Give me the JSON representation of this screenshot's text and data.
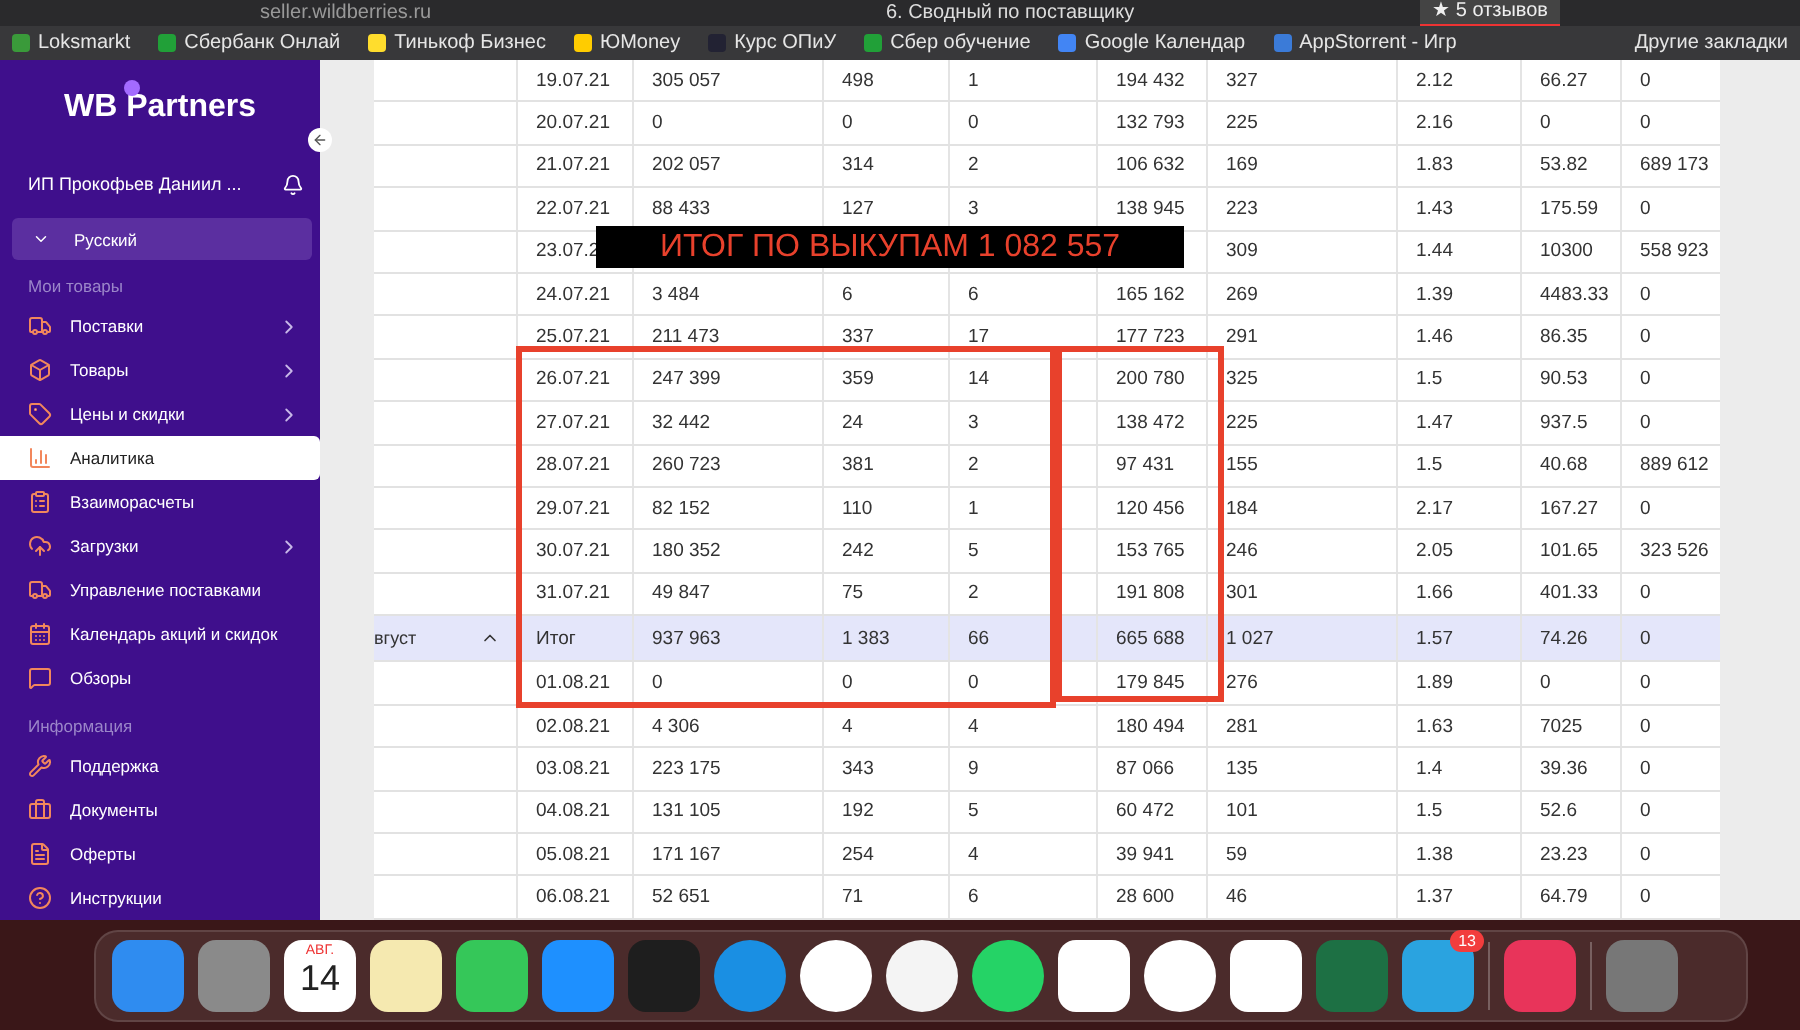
{
  "browser": {
    "address": "seller.wildberries.ru",
    "title": "6. Сводный по поставщику",
    "reviews": "★ 5 отзывов"
  },
  "bookmarks": [
    "Loksmarkt",
    "Сбербанк Онлай",
    "Тинькоф Бизнес",
    "ЮMoney",
    "Курс ОПиУ",
    "Сбер обучение",
    "Google Календар",
    "AppStorrent - Игр"
  ],
  "other_bookmarks": "Другие закладки",
  "sidebar": {
    "logo": "WB Partners",
    "user": "ИП Прокофьев Даниил ...",
    "language": "Русский",
    "sections": [
      {
        "title": "Мои товары",
        "items": [
          {
            "label": "Поставки",
            "submenu": true,
            "selected": false
          },
          {
            "label": "Товары",
            "submenu": true,
            "selected": false
          },
          {
            "label": "Цены и скидки",
            "submenu": true,
            "selected": false
          },
          {
            "label": "Аналитика",
            "submenu": false,
            "selected": true
          },
          {
            "label": "Взаиморасчеты",
            "submenu": false,
            "selected": false
          },
          {
            "label": "Загрузки",
            "submenu": true,
            "selected": false
          },
          {
            "label": "Управление поставками",
            "submenu": false,
            "selected": false
          },
          {
            "label": "Календарь акций и скидок",
            "submenu": false,
            "selected": false
          },
          {
            "label": "Обзоры",
            "submenu": false,
            "selected": false
          }
        ]
      },
      {
        "title": "Информация",
        "items": [
          {
            "label": "Поддержка",
            "submenu": false,
            "selected": false
          },
          {
            "label": "Документы",
            "submenu": false,
            "selected": false
          },
          {
            "label": "Оферты",
            "submenu": false,
            "selected": false
          },
          {
            "label": "Инструкции",
            "submenu": false,
            "selected": false
          }
        ]
      }
    ]
  },
  "table": {
    "rows": [
      {
        "kind": "day",
        "cells": [
          "19.07.21",
          "305 057",
          "498",
          "1",
          "194 432",
          "327",
          "2.12",
          "66.27",
          "0"
        ]
      },
      {
        "kind": "day",
        "cells": [
          "20.07.21",
          "0",
          "0",
          "0",
          "132 793",
          "225",
          "2.16",
          "0",
          "0"
        ]
      },
      {
        "kind": "day",
        "cells": [
          "21.07.21",
          "202 057",
          "314",
          "2",
          "106 632",
          "169",
          "1.83",
          "53.82",
          "689 173"
        ]
      },
      {
        "kind": "day",
        "cells": [
          "22.07.21",
          "88 433",
          "127",
          "3",
          "138 945",
          "223",
          "1.43",
          "175.59",
          "0"
        ]
      },
      {
        "kind": "day",
        "cells": [
          "23.07.2",
          null,
          null,
          null,
          null,
          "309",
          "1.44",
          "10300",
          "558 923"
        ]
      },
      {
        "kind": "day",
        "cells": [
          "24.07.21",
          "3 484",
          "6",
          "6",
          "165 162",
          "269",
          "1.39",
          "4483.33",
          "0"
        ]
      },
      {
        "kind": "day",
        "cells": [
          "25.07.21",
          "211 473",
          "337",
          "17",
          "177 723",
          "291",
          "1.46",
          "86.35",
          "0"
        ]
      },
      {
        "kind": "day",
        "cells": [
          "26.07.21",
          "247 399",
          "359",
          "14",
          "200 780",
          "325",
          "1.5",
          "90.53",
          "0"
        ]
      },
      {
        "kind": "day",
        "cells": [
          "27.07.21",
          "32 442",
          "24",
          "3",
          "138 472",
          "225",
          "1.47",
          "937.5",
          "0"
        ]
      },
      {
        "kind": "day",
        "cells": [
          "28.07.21",
          "260 723",
          "381",
          "2",
          "97 431",
          "155",
          "1.5",
          "40.68",
          "889 612"
        ]
      },
      {
        "kind": "day",
        "cells": [
          "29.07.21",
          "82 152",
          "110",
          "1",
          "120 456",
          "184",
          "2.17",
          "167.27",
          "0"
        ]
      },
      {
        "kind": "day",
        "cells": [
          "30.07.21",
          "180 352",
          "242",
          "5",
          "153 765",
          "246",
          "2.05",
          "101.65",
          "323 526"
        ]
      },
      {
        "kind": "day",
        "cells": [
          "31.07.21",
          "49 847",
          "75",
          "2",
          "191 808",
          "301",
          "1.66",
          "401.33",
          "0"
        ]
      },
      {
        "kind": "total",
        "group": "вгуст",
        "cells": [
          "Итог",
          "937 963",
          "1 383",
          "66",
          "665 688",
          "1 027",
          "1.57",
          "74.26",
          "0"
        ]
      },
      {
        "kind": "day",
        "cells": [
          "01.08.21",
          "0",
          "0",
          "0",
          "179 845",
          "276",
          "1.89",
          "0",
          "0"
        ]
      },
      {
        "kind": "day",
        "cells": [
          "02.08.21",
          "4 306",
          "4",
          "4",
          "180 494",
          "281",
          "1.63",
          "7025",
          "0"
        ]
      },
      {
        "kind": "day",
        "cells": [
          "03.08.21",
          "223 175",
          "343",
          "9",
          "87 066",
          "135",
          "1.4",
          "39.36",
          "0"
        ]
      },
      {
        "kind": "day",
        "cells": [
          "04.08.21",
          "131 105",
          "192",
          "5",
          "60 472",
          "101",
          "1.5",
          "52.6",
          "0"
        ]
      },
      {
        "kind": "day",
        "cells": [
          "05.08.21",
          "171 167",
          "254",
          "4",
          "39 941",
          "59",
          "1.38",
          "23.23",
          "0"
        ]
      },
      {
        "kind": "day",
        "cells": [
          "06.08.21",
          "52 651",
          "71",
          "6",
          "28 600",
          "46",
          "1.37",
          "64.79",
          "0"
        ]
      }
    ]
  },
  "annotation": "ИТОГ ПО ВЫКУПАМ 1 082 557",
  "dock": {
    "calendar_month": "АВГ.",
    "calendar_day": "14",
    "telegram_badge": "13"
  }
}
